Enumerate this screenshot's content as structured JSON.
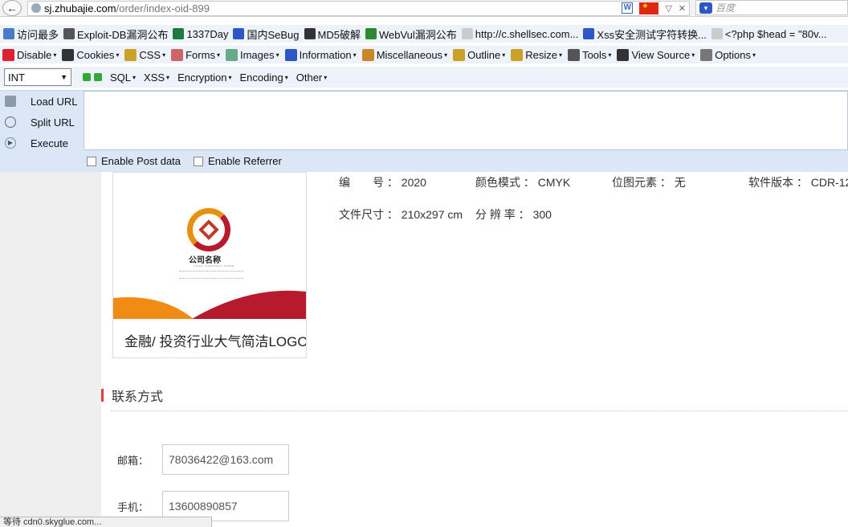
{
  "urlbar": {
    "host": "sj.zhubajie.com",
    "path": "/order/index-oid-899",
    "search_placeholder": "百度"
  },
  "bookmarks": [
    {
      "label": "访问最多",
      "icon": "bookmark-folder-icon",
      "color": "#4a7bc6"
    },
    {
      "label": "Exploit-DB漏洞公布",
      "icon": "exploit-db-icon",
      "color": "#555555"
    },
    {
      "label": "1337Day",
      "icon": "1337day-icon",
      "color": "#1f7a3e"
    },
    {
      "label": "国内SeBug",
      "icon": "sebug-icon",
      "color": "#2b58c5"
    },
    {
      "label": "MD5破解",
      "icon": "grid-icon",
      "color": "#333333"
    },
    {
      "label": "WebVul漏洞公布",
      "icon": "bug-icon",
      "color": "#2c8a2c"
    },
    {
      "label": "http://c.shellsec.com...",
      "icon": "page-icon",
      "color": "#cccccc"
    },
    {
      "label": "Xss安全测试字符转换...",
      "icon": "paw-icon",
      "color": "#2b58c5"
    },
    {
      "label": "<?php $head = \"80v...",
      "icon": "page-icon",
      "color": "#cccccc"
    }
  ],
  "hackbar_menu": [
    {
      "label": "Disable",
      "icon": "disable-icon",
      "color": "#d23"
    },
    {
      "label": "Cookies",
      "icon": "user-icon",
      "color": "#333"
    },
    {
      "label": "CSS",
      "icon": "pencil-icon",
      "color": "#c9a227"
    },
    {
      "label": "Forms",
      "icon": "form-icon",
      "color": "#c66"
    },
    {
      "label": "Images",
      "icon": "image-icon",
      "color": "#6a8"
    },
    {
      "label": "Information",
      "icon": "info-icon",
      "color": "#2b58c5"
    },
    {
      "label": "Miscellaneous",
      "icon": "misc-icon",
      "color": "#c9862b"
    },
    {
      "label": "Outline",
      "icon": "pencil-icon",
      "color": "#c9a227"
    },
    {
      "label": "Resize",
      "icon": "resize-icon",
      "color": "#c9a227"
    },
    {
      "label": "Tools",
      "icon": "tools-icon",
      "color": "#555"
    },
    {
      "label": "View Source",
      "icon": "source-icon",
      "color": "#333"
    },
    {
      "label": "Options",
      "icon": "options-icon",
      "color": "#777"
    }
  ],
  "hackbar_row2": {
    "select_value": "INT",
    "items": [
      "SQL",
      "XSS",
      "Encryption",
      "Encoding",
      "Other"
    ]
  },
  "hackbar_panel": {
    "load_url": "Load URL",
    "split_url": "Split URL",
    "execute": "Execute",
    "enable_post": "Enable Post data",
    "enable_referrer": "Enable Referrer"
  },
  "product": {
    "title": "金融/ 投资行业大气简洁LOGO",
    "logo_name": "公司名称",
    "logo_sub": "YOUR COMPANY NAME",
    "meta": {
      "id_label": "编　　号 ：",
      "id_value": "2020",
      "color_label": "颜色模式 ：",
      "color_value": "CMYK",
      "bitmap_label": "位图元素 ：",
      "bitmap_value": "无",
      "software_label": "软件版本 ：",
      "software_value": "CDR-12",
      "size_label": "文件尺寸 ：",
      "size_value": "210x297 cm",
      "resolution_label": "分 辨 率 ：",
      "resolution_value": "300"
    }
  },
  "contact": {
    "title": "联系方式",
    "email_label": "邮箱：",
    "email_value": "78036422@163.com",
    "phone_label": "手机：",
    "phone_value": "13600890857"
  },
  "status": "等待 cdn0.skyglue.com...",
  "colors": {
    "accent_red": "#d6413c",
    "logo_orange": "#e7900f",
    "logo_red": "#b7192d"
  }
}
